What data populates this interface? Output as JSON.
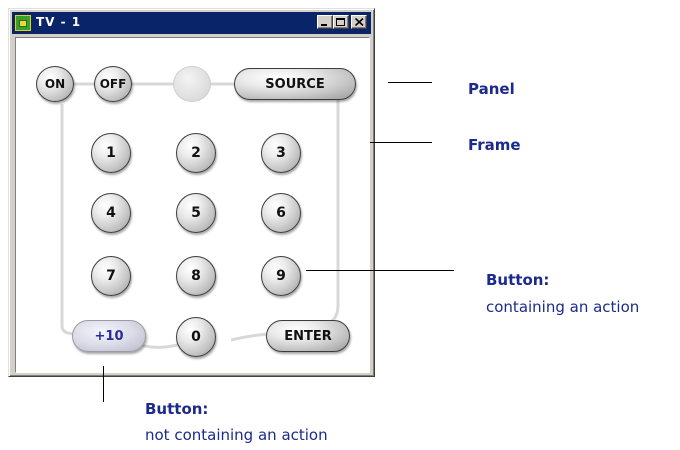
{
  "window": {
    "title": "TV - 1",
    "controls": [
      "minimize",
      "maximize",
      "close"
    ]
  },
  "remote": {
    "top_row": [
      "ON",
      "OFF",
      "",
      "SOURCE"
    ],
    "digits": [
      "1",
      "2",
      "3",
      "4",
      "5",
      "6",
      "7",
      "8",
      "9"
    ],
    "bottom_row": [
      "+10",
      "0",
      "ENTER"
    ]
  },
  "annotations": {
    "panel": "Panel",
    "frame": "Frame",
    "button_action_title": "Button:",
    "button_action_desc": "containing an action",
    "button_noaction_title": "Button:",
    "button_noaction_desc": "not containing an action"
  },
  "colors": {
    "titlebar": "#0a246a",
    "annotation_text": "#1c2a8c",
    "window_face": "#d4d0c8"
  },
  "icons": {
    "app_icon": "tv-remote-app-icon",
    "minimize": "minimize-icon",
    "maximize": "maximize-icon",
    "close": "close-icon"
  }
}
